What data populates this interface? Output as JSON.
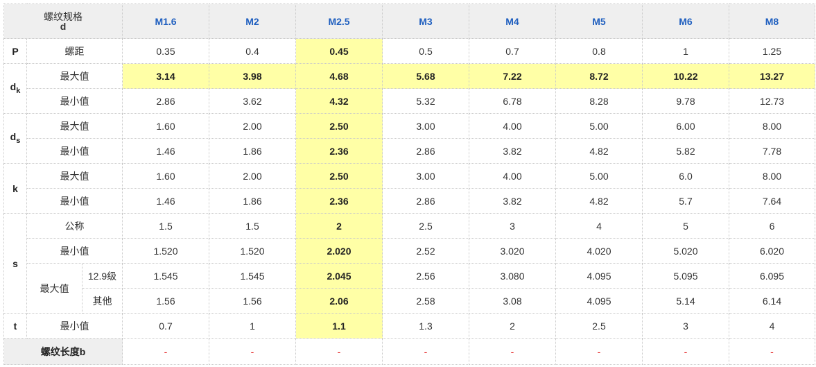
{
  "header": {
    "corner_line1": "螺纹规格",
    "corner_line2": "d",
    "sizes": [
      "M1.6",
      "M2",
      "M2.5",
      "M3",
      "M4",
      "M5",
      "M6",
      "M8"
    ]
  },
  "symbols": {
    "P": "P",
    "dk_main": "d",
    "dk_sub": "k",
    "ds_main": "d",
    "ds_sub": "s",
    "k": "k",
    "s": "s",
    "t": "t"
  },
  "labels": {
    "pitch": "螺距",
    "max": "最大值",
    "min": "最小值",
    "nominal": "公称",
    "grade": "12.9级",
    "other": "其他",
    "thread_length": "螺纹长度b"
  },
  "rows": {
    "P": [
      "0.35",
      "0.4",
      "0.45",
      "0.5",
      "0.7",
      "0.8",
      "1",
      "1.25"
    ],
    "dk_max": [
      "3.14",
      "3.98",
      "4.68",
      "5.68",
      "7.22",
      "8.72",
      "10.22",
      "13.27"
    ],
    "dk_min": [
      "2.86",
      "3.62",
      "4.32",
      "5.32",
      "6.78",
      "8.28",
      "9.78",
      "12.73"
    ],
    "ds_max": [
      "1.60",
      "2.00",
      "2.50",
      "3.00",
      "4.00",
      "5.00",
      "6.00",
      "8.00"
    ],
    "ds_min": [
      "1.46",
      "1.86",
      "2.36",
      "2.86",
      "3.82",
      "4.82",
      "5.82",
      "7.78"
    ],
    "k_max": [
      "1.60",
      "2.00",
      "2.50",
      "3.00",
      "4.00",
      "5.00",
      "6.0",
      "8.00"
    ],
    "k_min": [
      "1.46",
      "1.86",
      "2.36",
      "2.86",
      "3.82",
      "4.82",
      "5.7",
      "7.64"
    ],
    "s_nominal": [
      "1.5",
      "1.5",
      "2",
      "2.5",
      "3",
      "4",
      "5",
      "6"
    ],
    "s_min": [
      "1.520",
      "1.520",
      "2.020",
      "2.52",
      "3.020",
      "4.020",
      "5.020",
      "6.020"
    ],
    "s_max_129": [
      "1.545",
      "1.545",
      "2.045",
      "2.56",
      "3.080",
      "4.095",
      "5.095",
      "6.095"
    ],
    "s_max_other": [
      "1.56",
      "1.56",
      "2.06",
      "2.58",
      "3.08",
      "4.095",
      "5.14",
      "6.14"
    ],
    "t_min": [
      "0.7",
      "1",
      "1.1",
      "1.3",
      "2",
      "2.5",
      "3",
      "4"
    ],
    "b": [
      "-",
      "-",
      "-",
      "-",
      "-",
      "-",
      "-",
      "-"
    ]
  },
  "highlight": {
    "column": "M2.5",
    "row": "dk_max",
    "color": "#ffffa6"
  },
  "colors": {
    "size_header": "#1f5fbf",
    "dash": "#e00000",
    "header_bg": "#efefef"
  }
}
